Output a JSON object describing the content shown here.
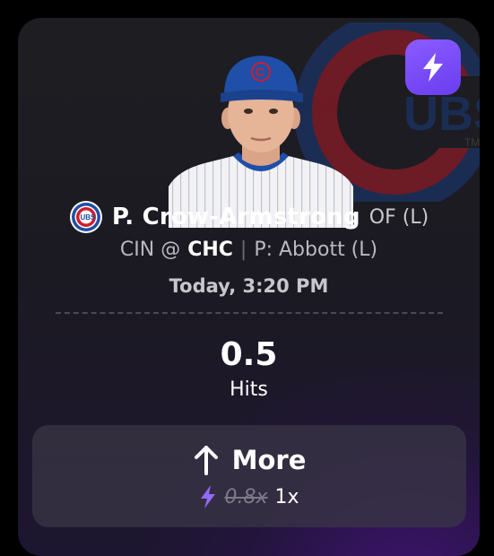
{
  "card": {
    "boost_icon": "lightning-bolt-icon",
    "team_logo_icon": "cubs-logo-icon",
    "team_logo_text": "UBS",
    "watermark_text": "UBS",
    "watermark_tm": "TM",
    "player_cap_letter": "C"
  },
  "player": {
    "name": "P. Crow-Armstrong",
    "position": "OF (L)"
  },
  "game": {
    "away": "CIN @",
    "home": "CHC",
    "separator": "|",
    "pitcher": "P: Abbott (L)",
    "time": "Today, 3:20 PM"
  },
  "projection": {
    "value": "0.5",
    "stat": "Hits"
  },
  "pick": {
    "label": "More",
    "arrow_icon": "arrow-up-icon",
    "old_multiplier": "0.8x",
    "new_multiplier": "1x"
  },
  "colors": {
    "badge": "#7b4dff",
    "cubs_blue": "#1f4fa8",
    "cubs_red": "#cc1f2d"
  }
}
